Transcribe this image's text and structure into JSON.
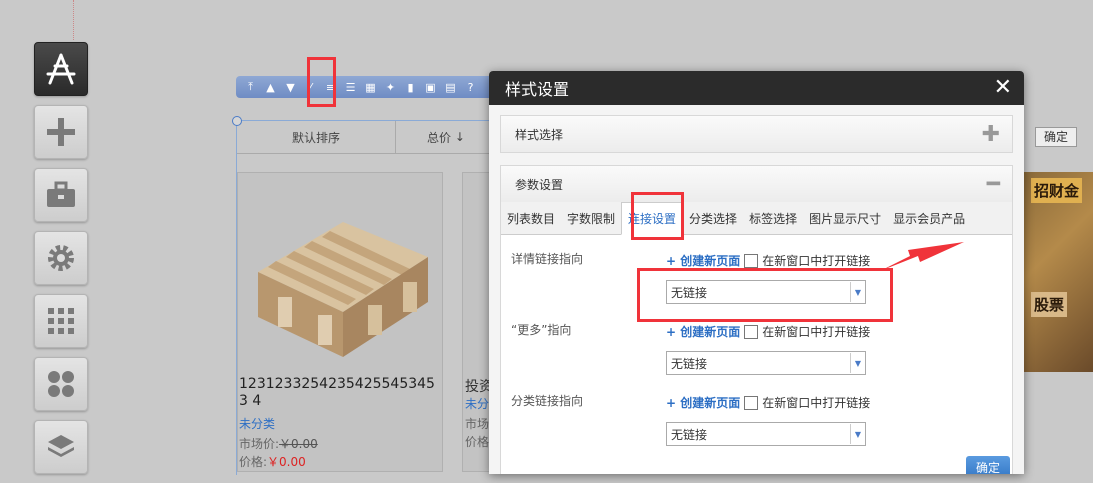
{
  "sidebar": {
    "items": [
      {
        "icon": "app-store-icon",
        "active": true
      },
      {
        "icon": "plus-icon",
        "active": false
      },
      {
        "icon": "toolbox-icon",
        "active": false
      },
      {
        "icon": "gear-icon",
        "active": false
      },
      {
        "icon": "grid-icon",
        "active": false
      },
      {
        "icon": "clover-icon",
        "active": false
      },
      {
        "icon": "layers-icon",
        "active": false
      }
    ]
  },
  "toolbar": {
    "buttons": [
      "move-top-icon",
      "move-up-icon",
      "move-down-icon",
      "link-icon",
      "style-icon",
      "list-icon",
      "table-icon",
      "magic-icon",
      "chart-icon",
      "lock-icon",
      "delete-icon",
      "help-icon"
    ]
  },
  "module": {
    "sort_default": "默认排序",
    "sort_total": "总价",
    "sort_arrow": "↓",
    "confirm_label": "确定"
  },
  "products": [
    {
      "title": "12312332542354255453453 4",
      "category": "未分类",
      "market_label": "市场价:",
      "market_price": "￥0.00",
      "price_label": "价格:",
      "price": "￥0.00"
    },
    {
      "title": "投资",
      "category": "未分",
      "market_label": "市场",
      "price_label": "价格"
    }
  ],
  "banner": {
    "text1": "招财金",
    "text2": "股票"
  },
  "dialog": {
    "title": "样式设置",
    "close": "✕",
    "style_section": {
      "title": "样式选择",
      "toggle": "✚"
    },
    "param_section": {
      "title": "参数设置",
      "toggle": "━"
    },
    "tabs": [
      "列表数目",
      "字数限制",
      "连接设置",
      "分类选择",
      "标签选择",
      "图片显示尺寸",
      "显示会员产品"
    ],
    "active_tab": "连接设置",
    "fields": [
      {
        "label": "详情链接指向",
        "create": "+ 创建新页面",
        "new_window": "在新窗口中打开链接",
        "select": "无链接"
      },
      {
        "label": "“更多”指向",
        "create": "+ 创建新页面",
        "new_window": "在新窗口中打开链接",
        "select": "无链接"
      },
      {
        "label": "分类链接指向",
        "create": "+ 创建新页面",
        "new_window": "在新窗口中打开链接",
        "select": "无链接"
      }
    ],
    "confirm": "确定"
  },
  "colors": {
    "highlight": "#f0333a",
    "accent": "#2d6fc4",
    "dialog_header": "#2b2b2b"
  }
}
